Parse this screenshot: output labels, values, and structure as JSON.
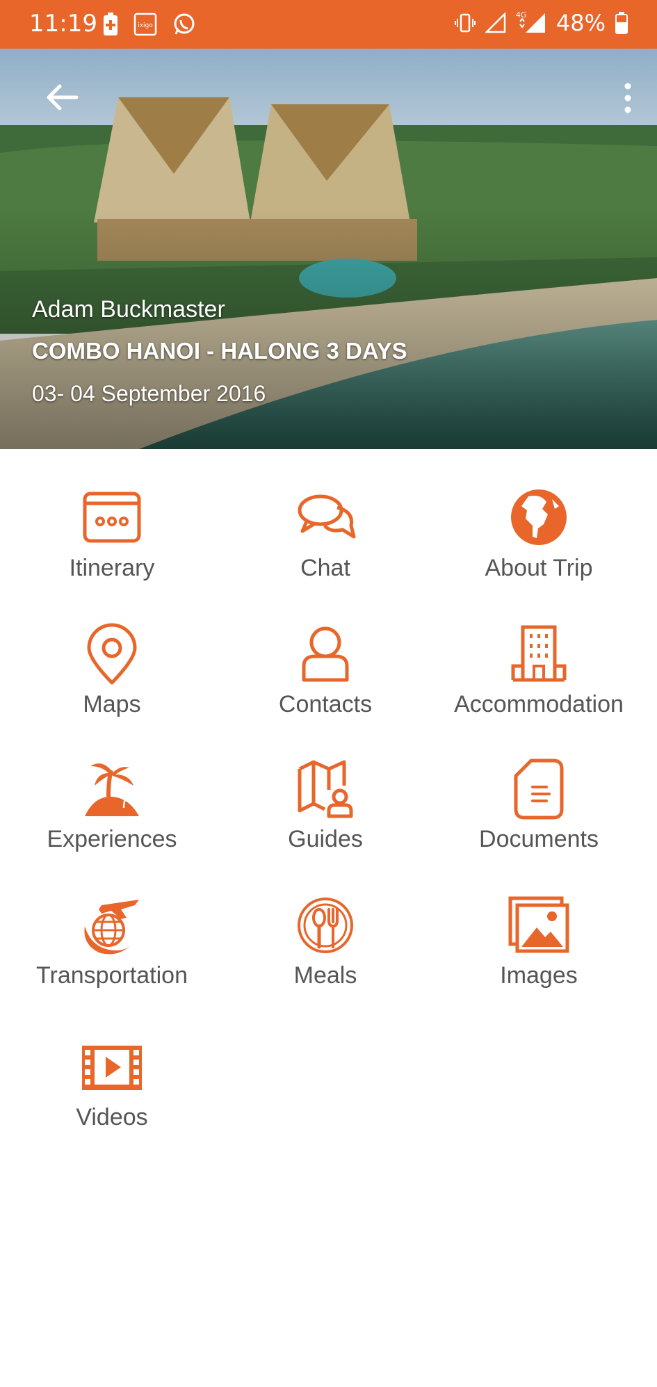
{
  "status_bar": {
    "time": "11:19",
    "battery": "48%",
    "network": "4G",
    "notification_icons": [
      "battery-saver-icon",
      "ixigo-icon",
      "whatsapp-icon"
    ]
  },
  "trip": {
    "traveler_name": "Adam Buckmaster",
    "title": "COMBO HANOI - HALONG 3 DAYS",
    "dates": "03- 04 September 2016"
  },
  "menu": {
    "items": [
      {
        "label": "Itinerary",
        "icon": "calendar-icon"
      },
      {
        "label": "Chat",
        "icon": "chat-bubbles-icon"
      },
      {
        "label": "About Trip",
        "icon": "globe-icon"
      },
      {
        "label": "Maps",
        "icon": "map-pin-icon"
      },
      {
        "label": "Contacts",
        "icon": "person-icon"
      },
      {
        "label": "Accommodation",
        "icon": "building-icon"
      },
      {
        "label": "Experiences",
        "icon": "palm-tree-icon"
      },
      {
        "label": "Guides",
        "icon": "guide-map-icon"
      },
      {
        "label": "Documents",
        "icon": "document-icon"
      },
      {
        "label": "Transportation",
        "icon": "plane-globe-icon"
      },
      {
        "label": "Meals",
        "icon": "fork-spoon-icon"
      },
      {
        "label": "Images",
        "icon": "images-icon"
      },
      {
        "label": "Videos",
        "icon": "film-icon"
      }
    ]
  },
  "colors": {
    "accent": "#E8662A",
    "label_text": "#555555"
  }
}
